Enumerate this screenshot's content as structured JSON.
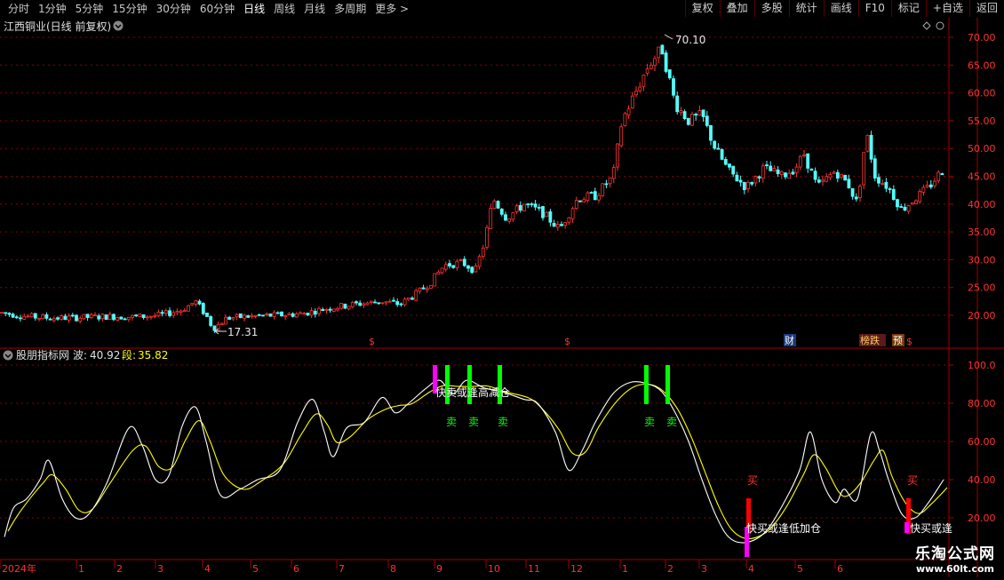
{
  "toolbar": {
    "periods": [
      "分时",
      "1分钟",
      "5分钟",
      "15分钟",
      "30分钟",
      "60分钟",
      "日线",
      "周线",
      "月线",
      "多周期",
      "更多 >"
    ],
    "active_period": "日线",
    "actions": [
      "复权",
      "叠加",
      "多股",
      "统计",
      "画线",
      "F10",
      "标记",
      "+自选",
      "返回"
    ]
  },
  "main_chart": {
    "title": "江西铜业(日线 前复权)",
    "high_label": "70.10",
    "low_label": "17.31",
    "y_ticks": [
      "70.00",
      "65.00",
      "60.00",
      "55.00",
      "50.00",
      "45.00",
      "40.00",
      "35.00",
      "30.00",
      "25.00",
      "20.00"
    ],
    "badges": [
      "$",
      "$",
      "财",
      "榜跌",
      "预",
      "$"
    ]
  },
  "indicator": {
    "name": "股朋指标网",
    "wave_label": "波:",
    "wave_value": "40.92",
    "seg_label": "段:",
    "seg_value": "35.82",
    "y_ticks": [
      "100.0",
      "80.00",
      "60.00",
      "40.00",
      "20.00"
    ],
    "annotations": {
      "sell_label": "卖",
      "buy_label": "买",
      "sell_text": "快卖或逢高减仓",
      "buy_text": "快买或逢低加仓",
      "buy_text_short": "快买或逢"
    }
  },
  "time_axis": {
    "labels": [
      "2024年",
      "1",
      "2",
      "3",
      "4",
      "5",
      "6",
      "7",
      "8",
      "9",
      "10",
      "11",
      "12",
      "1",
      "2",
      "3",
      "4",
      "5",
      "6"
    ]
  },
  "watermark": {
    "line1": "乐淘公式网",
    "line2": "www.60lt.com"
  },
  "colors": {
    "up": "#ff3232",
    "down": "#54fcfc",
    "grid": "#8b0000",
    "wave": "#ffffff",
    "segment": "#ffff00",
    "sell_bar": "#00ff00",
    "buy_bar": "#ff0000",
    "magenta": "#ff00ff"
  },
  "chart_data": {
    "type": "candlestick",
    "y_range": [
      17,
      72
    ],
    "price_path": [
      [
        0,
        20.5
      ],
      [
        30,
        19.8
      ],
      [
        60,
        19.5
      ],
      [
        90,
        19.6
      ],
      [
        120,
        19.8
      ],
      [
        150,
        19.7
      ],
      [
        180,
        20.0
      ],
      [
        205,
        21.0
      ],
      [
        220,
        22.5
      ],
      [
        232,
        20.0
      ],
      [
        240,
        17.6
      ],
      [
        255,
        19.5
      ],
      [
        280,
        19.8
      ],
      [
        310,
        20.0
      ],
      [
        340,
        20.3
      ],
      [
        370,
        21.3
      ],
      [
        400,
        22.0
      ],
      [
        430,
        22.5
      ],
      [
        450,
        22.0
      ],
      [
        470,
        24.0
      ],
      [
        485,
        26.0
      ],
      [
        500,
        29.0
      ],
      [
        520,
        29.5
      ],
      [
        535,
        28.0
      ],
      [
        545,
        33.0
      ],
      [
        555,
        41.0
      ],
      [
        570,
        37.5
      ],
      [
        590,
        40.0
      ],
      [
        610,
        38.5
      ],
      [
        630,
        35.5
      ],
      [
        650,
        41.0
      ],
      [
        670,
        41.5
      ],
      [
        690,
        45.0
      ],
      [
        700,
        55.0
      ],
      [
        715,
        60.0
      ],
      [
        730,
        65.0
      ],
      [
        745,
        68.0
      ],
      [
        760,
        58.0
      ],
      [
        775,
        55.0
      ],
      [
        790,
        56.0
      ],
      [
        805,
        50.0
      ],
      [
        820,
        46.0
      ],
      [
        840,
        43.0
      ],
      [
        860,
        46.5
      ],
      [
        880,
        45.0
      ],
      [
        895,
        46.5
      ],
      [
        905,
        49.0
      ],
      [
        920,
        43.0
      ],
      [
        940,
        46.0
      ],
      [
        955,
        43.5
      ],
      [
        965,
        40.0
      ],
      [
        975,
        53.0
      ],
      [
        985,
        45.0
      ],
      [
        1000,
        43.0
      ],
      [
        1015,
        39.0
      ],
      [
        1030,
        41.0
      ],
      [
        1045,
        43.0
      ],
      [
        1060,
        46.0
      ]
    ],
    "indicator_range": [
      0,
      105
    ],
    "wave_series": [
      [
        5,
        10
      ],
      [
        15,
        25
      ],
      [
        30,
        30
      ],
      [
        45,
        40
      ],
      [
        55,
        50
      ],
      [
        70,
        30
      ],
      [
        85,
        20
      ],
      [
        100,
        22
      ],
      [
        120,
        38
      ],
      [
        145,
        67
      ],
      [
        160,
        58
      ],
      [
        175,
        40
      ],
      [
        190,
        42
      ],
      [
        205,
        68
      ],
      [
        220,
        78
      ],
      [
        232,
        60
      ],
      [
        248,
        32
      ],
      [
        270,
        35
      ],
      [
        290,
        40
      ],
      [
        315,
        45
      ],
      [
        335,
        70
      ],
      [
        352,
        82
      ],
      [
        365,
        65
      ],
      [
        375,
        52
      ],
      [
        390,
        67
      ],
      [
        410,
        70
      ],
      [
        430,
        83
      ],
      [
        445,
        75
      ],
      [
        460,
        80
      ],
      [
        480,
        88
      ],
      [
        495,
        92
      ],
      [
        510,
        85
      ],
      [
        525,
        92
      ],
      [
        545,
        88
      ],
      [
        565,
        86
      ],
      [
        590,
        82
      ],
      [
        605,
        80
      ],
      [
        625,
        65
      ],
      [
        640,
        45
      ],
      [
        655,
        55
      ],
      [
        670,
        70
      ],
      [
        690,
        85
      ],
      [
        710,
        91
      ],
      [
        730,
        90
      ],
      [
        745,
        86
      ],
      [
        760,
        75
      ],
      [
        775,
        60
      ],
      [
        790,
        40
      ],
      [
        805,
        22
      ],
      [
        820,
        10
      ],
      [
        838,
        7
      ],
      [
        860,
        12
      ],
      [
        880,
        26
      ],
      [
        900,
        45
      ],
      [
        912,
        65
      ],
      [
        925,
        40
      ],
      [
        940,
        28
      ],
      [
        950,
        35
      ],
      [
        965,
        30
      ],
      [
        980,
        64
      ],
      [
        990,
        55
      ],
      [
        1000,
        40
      ],
      [
        1015,
        22
      ],
      [
        1030,
        20
      ],
      [
        1045,
        28
      ],
      [
        1062,
        40
      ]
    ],
    "wave_value": 40.92,
    "segment_value": 35.82,
    "sell_signals_x": [
      503,
      528,
      562,
      727,
      751
    ],
    "buy_signals_x": [
      842,
      1022
    ],
    "time_axis_labels": [
      "2024年",
      "1",
      "2",
      "3",
      "4",
      "5",
      "6",
      "7",
      "8",
      "9",
      "10",
      "11",
      "12",
      "1",
      "2",
      "3",
      "4",
      "5",
      "6"
    ]
  }
}
